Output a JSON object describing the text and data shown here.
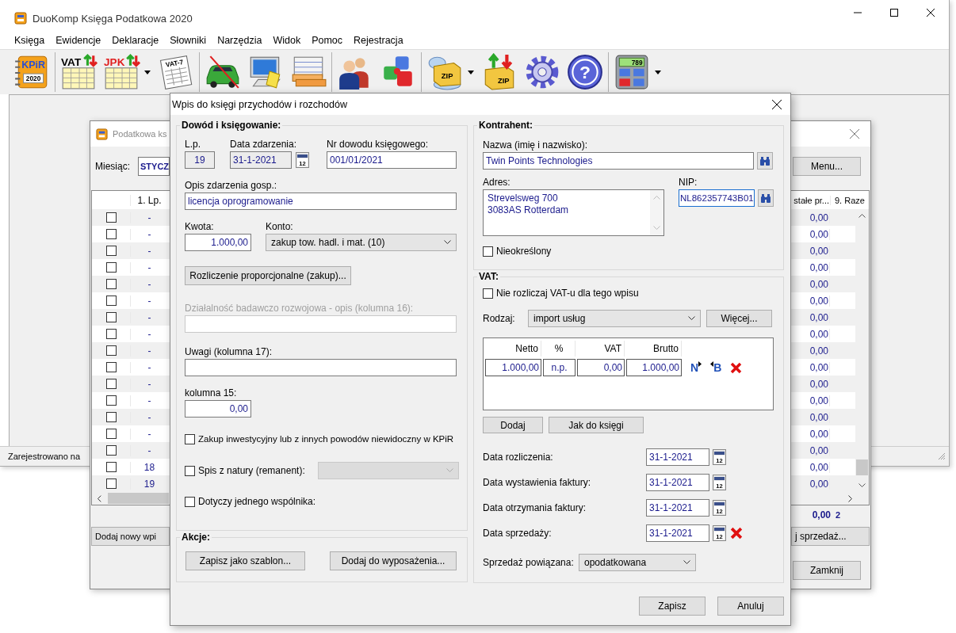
{
  "app": {
    "title": "DuoKomp Księga Podatkowa 2020",
    "menu": [
      "Księga",
      "Ewidencje",
      "Deklaracje",
      "Słowniki",
      "Narzędzia",
      "Widok",
      "Pomoc",
      "Rejestracja"
    ],
    "toolbar": [
      [
        {
          "kind": "kpir",
          "label": "KPiR",
          "sublabel": "2020"
        }
      ],
      [
        {
          "kind": "sheet",
          "label": "VAT",
          "color": "#000000"
        },
        {
          "kind": "sheet",
          "label": "JPK",
          "color": "#e02020",
          "dropdown": true
        },
        {
          "kind": "form",
          "label": "VAT-7"
        }
      ],
      [
        {
          "kind": "car"
        },
        {
          "kind": "computer"
        },
        {
          "kind": "money"
        }
      ],
      [
        {
          "kind": "people"
        },
        {
          "kind": "puzzle"
        }
      ],
      [
        {
          "kind": "zip-cloud",
          "label": "ZIP",
          "dropdown": true
        },
        {
          "kind": "zip-arrows",
          "label": "ZIP"
        },
        {
          "kind": "gear"
        },
        {
          "kind": "help",
          "label": "?"
        }
      ],
      [
        {
          "kind": "calculator",
          "label": "789",
          "dropdown": true
        }
      ]
    ],
    "status": "Zarejestrowano na"
  },
  "ledger_window": {
    "title": "Podatkowa ks",
    "month_label": "Miesiąc:",
    "month_value": "STYCZ",
    "menu_button": "Menu...",
    "columns": [
      "1. Lp.",
      "stałe pr...",
      "9. Raze"
    ],
    "rows": [
      {
        "checked": false,
        "lp": "-",
        "value": "0,00"
      },
      {
        "checked": false,
        "lp": "-",
        "value": "0,00"
      },
      {
        "checked": false,
        "lp": "-",
        "value": "0,00"
      },
      {
        "checked": false,
        "lp": "-",
        "value": "0,00"
      },
      {
        "checked": false,
        "lp": "-",
        "value": "0,00"
      },
      {
        "checked": false,
        "lp": "-",
        "value": "0,00"
      },
      {
        "checked": false,
        "lp": "-",
        "value": "0,00"
      },
      {
        "checked": false,
        "lp": "-",
        "value": "0,00"
      },
      {
        "checked": false,
        "lp": "-",
        "value": "0,00"
      },
      {
        "checked": false,
        "lp": "-",
        "value": "0,00"
      },
      {
        "checked": false,
        "lp": "-",
        "value": "0,00"
      },
      {
        "checked": false,
        "lp": "-",
        "value": "0,00"
      },
      {
        "checked": false,
        "lp": "-",
        "value": "0,00"
      },
      {
        "checked": false,
        "lp": "-",
        "value": "0,00"
      },
      {
        "checked": false,
        "lp": "-",
        "value": "0,00"
      },
      {
        "checked": false,
        "lp": "18",
        "value": "0,00"
      },
      {
        "checked": false,
        "lp": "19",
        "value": "0,00"
      }
    ],
    "totals": [
      "0,00",
      "2"
    ],
    "buttons": [
      "Dodaj nowy wpi",
      "j sprzedaż...",
      "Zamknij"
    ]
  },
  "dialog": {
    "title": "Wpis do księgi przychodów i rozchodów",
    "entry": {
      "legend": "Dowód i księgowanie:",
      "lp": {
        "label": "L.p.",
        "value": "19"
      },
      "date": {
        "label": "Data zdarzenia:",
        "value": "31-1-2021",
        "calendar": "12"
      },
      "doc_no": {
        "label": "Nr dowodu księgowego:",
        "value": "001/01/2021"
      },
      "description": {
        "label": "Opis zdarzenia gosp.:",
        "value": "licencja oprogramowanie"
      },
      "amount": {
        "label": "Kwota:",
        "value": "1.000,00"
      },
      "account": {
        "label": "Konto:",
        "value": "zakup tow. hadl. i mat. (10)"
      },
      "proportional_button": "Rozliczenie proporcjonalne (zakup)...",
      "research": {
        "label": "Działalność badawczo rozwojowa - opis (kolumna 16):",
        "disabled": true
      },
      "notes": {
        "label": "Uwagi (kolumna 17):"
      },
      "column15": {
        "label": "kolumna 15:",
        "value": "0,00"
      },
      "checks": [
        {
          "kind": "plain",
          "label": "Zakup inwestycyjny lub z innych powodów niewidoczny w KPiR",
          "checked": false
        },
        {
          "kind": "with-select",
          "label": "Spis z natury (remanent):",
          "checked": false,
          "select_disabled": true
        },
        {
          "kind": "plain",
          "label": "Dotyczy jednego wspólnika:",
          "checked": false
        }
      ]
    },
    "actions": {
      "legend": "Akcje:",
      "buttons": [
        "Zapisz jako szablon...",
        "Dodaj do wyposażenia..."
      ]
    },
    "contractor": {
      "legend": "Kontrahent:",
      "name": {
        "label": "Nazwa (imię i nazwisko):",
        "value": "Twin Points Technologies"
      },
      "address": {
        "label": "Adres:",
        "lines": [
          "Strevelsweg 700",
          "3083AS Rotterdam"
        ]
      },
      "nip": {
        "label": "NIP:",
        "value": "NL862357743B01",
        "focused": true
      },
      "unspecified": {
        "label": "Nieokreślony",
        "checked": false
      }
    },
    "vat": {
      "legend": "VAT:",
      "skip": {
        "label": "Nie rozliczaj VAT-u dla tego wpisu",
        "checked": false
      },
      "type_select": {
        "label": "Rodzaj:",
        "value": "import usług"
      },
      "more_button": "Więcej...",
      "columns": [
        "Netto",
        "%",
        "VAT",
        "Brutto"
      ],
      "rows": [
        {
          "cells": [
            "1.000,00",
            "n.p.",
            "0,00",
            "1.000,00"
          ],
          "actions": [
            {
              "kind": "net",
              "label": "N"
            },
            {
              "kind": "gross",
              "label": "B"
            },
            {
              "kind": "delete"
            }
          ]
        }
      ],
      "buttons": [
        "Dodaj",
        "Jak do księgi"
      ],
      "dates": [
        {
          "label": "Data rozliczenia:",
          "value": "31-1-2021",
          "calendar": "12",
          "clearable": false
        },
        {
          "label": "Data wystawienia faktury:",
          "value": "31-1-2021",
          "calendar": "12",
          "clearable": false
        },
        {
          "label": "Data otrzymania faktury:",
          "value": "31-1-2021",
          "calendar": "12",
          "clearable": false
        },
        {
          "label": "Data sprzedaży:",
          "value": "31-1-2021",
          "calendar": "12",
          "clearable": true
        }
      ],
      "linked_sale": {
        "label": "Sprzedaż powiązana:",
        "value": "opodatkowana"
      }
    },
    "footer_buttons": [
      "Zapisz",
      "Anuluj"
    ]
  }
}
